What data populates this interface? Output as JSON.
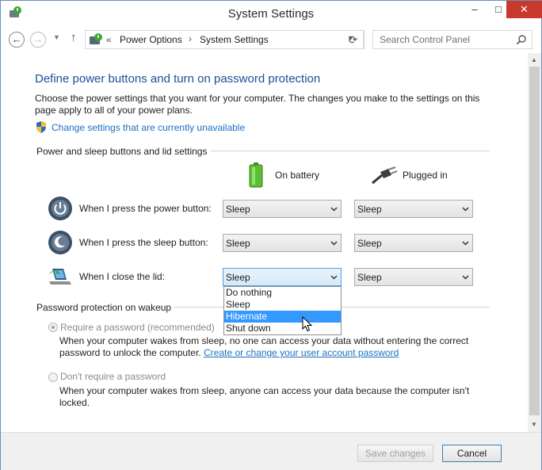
{
  "window": {
    "title": "System Settings",
    "minimize": "–",
    "maximize": "□",
    "close": "✕"
  },
  "address": {
    "sep0": "«",
    "crumbs": [
      "Power Options",
      "System Settings"
    ],
    "sep": "›",
    "refresh": "⟳",
    "search_placeholder": "Search Control Panel"
  },
  "nav": {
    "back": "←",
    "forward": "→",
    "recent": "▼",
    "up": "↑"
  },
  "content": {
    "heading": "Define power buttons and turn on password protection",
    "description": "Choose the power settings that you want for your computer. The changes you make to the settings on this page apply to all of your power plans.",
    "change_link": "Change settings that are currently unavailable",
    "section1": "Power and sleep buttons and lid settings",
    "col_battery": "On battery",
    "col_plugged": "Plugged in",
    "rows": [
      {
        "label": "When I press the power button:",
        "battery": "Sleep",
        "plugged": "Sleep"
      },
      {
        "label": "When I press the sleep button:",
        "battery": "Sleep",
        "plugged": "Sleep"
      },
      {
        "label": "When I close the lid:",
        "battery": "Sleep",
        "plugged": "Sleep"
      }
    ],
    "dropdown_options": [
      "Do nothing",
      "Sleep",
      "Hibernate",
      "Shut down"
    ],
    "dropdown_highlighted": "Hibernate",
    "section2": "Password protection on wakeup",
    "radio1_label": "Require a password (recommended)",
    "radio1_desc": "When your computer wakes from sleep, no one can access your data without entering the correct password to unlock the computer.",
    "radio1_link": "Create or change your user account password",
    "radio2_label": "Don't require a password",
    "radio2_desc": "When your computer wakes from sleep, anyone can access your data because the computer isn't locked."
  },
  "footer": {
    "save": "Save changes",
    "cancel": "Cancel"
  },
  "colors": {
    "heading": "#1e4e9a",
    "link": "#1a6fc4",
    "highlight": "#3399ff",
    "close": "#c7392c"
  }
}
